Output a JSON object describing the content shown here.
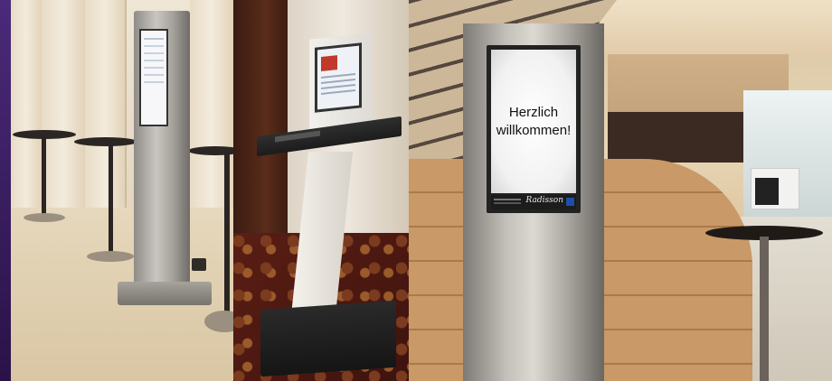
{
  "photo": {
    "panels": [
      {
        "id": "panel-lobby-stele",
        "subject": "stainless steel information stele beside bar tables"
      },
      {
        "id": "panel-terminal-desk",
        "subject": "white kiosk terminal with keyboard shelf"
      },
      {
        "id": "panel-reception-stele",
        "subject": "stainless steel digital signage stele in hotel lobby"
      }
    ],
    "stele_screen": {
      "welcome_text": "Herzlich\nwillkommen!",
      "brand_text": "Radisson"
    },
    "colors": {
      "frame_border": "#3a1f63",
      "steel": "#c2beb8",
      "wood": "#c99967",
      "carpet": "#5a1e14"
    }
  }
}
